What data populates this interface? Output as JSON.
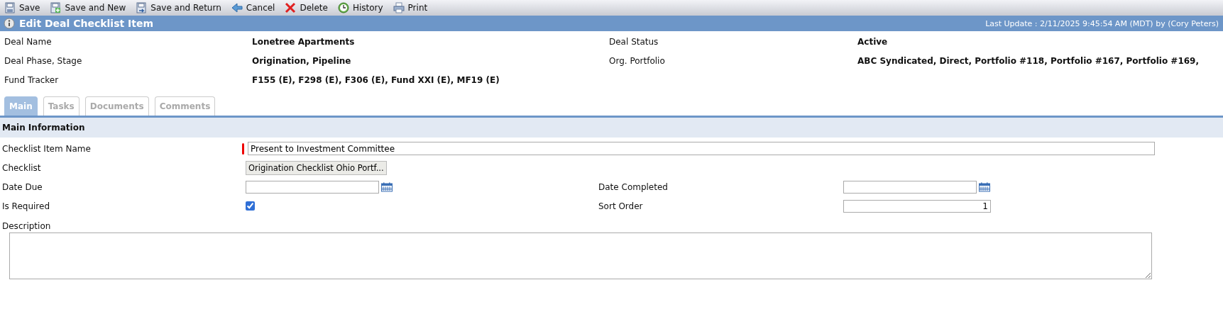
{
  "toolbar": [
    {
      "kind": "save",
      "label": "Save"
    },
    {
      "kind": "save-new",
      "label": "Save and New"
    },
    {
      "kind": "save-return",
      "label": "Save and Return"
    },
    {
      "kind": "cancel",
      "label": "Cancel"
    },
    {
      "kind": "delete",
      "label": "Delete"
    },
    {
      "kind": "history",
      "label": "History"
    },
    {
      "kind": "print",
      "label": "Print"
    }
  ],
  "header": {
    "title": "Edit Deal Checklist Item",
    "last_update": "Last Update : 2/11/2025 9:45:54 AM (MDT) by (Cory Peters)"
  },
  "summary": [
    [
      {
        "label": "Deal Name",
        "value": "Lonetree Apartments"
      },
      {
        "label": "Deal Status",
        "value": "Active"
      }
    ],
    [
      {
        "label": "Deal Phase, Stage",
        "value": "Origination, Pipeline"
      },
      {
        "label": "Org. Portfolio",
        "value": "ABC Syndicated, Direct, Portfolio #118, Portfolio #167, Portfolio #169,"
      }
    ],
    [
      {
        "label": "Fund Tracker",
        "value": "F155 (E), F298 (E), F306 (E), Fund XXI (E), MF19 (E)"
      }
    ]
  ],
  "tabs": [
    {
      "label": "Main",
      "selected": true
    },
    {
      "label": "Tasks",
      "selected": false
    },
    {
      "label": "Documents",
      "selected": false
    },
    {
      "label": "Comments",
      "selected": false
    }
  ],
  "section": {
    "title": "Main Information"
  },
  "form": [
    [
      {
        "kind": "text",
        "label": "Checklist Item Name",
        "value": "Present to Investment Committee",
        "required": true
      }
    ],
    [
      {
        "kind": "button",
        "label": "Checklist",
        "value": "Origination Checklist Ohio Portf..."
      }
    ],
    [
      {
        "kind": "date",
        "label": "Date Due"
      },
      {
        "kind": "date",
        "label": "Date Completed"
      }
    ],
    [
      {
        "kind": "checkbox",
        "label": "Is Required",
        "checked": true
      },
      {
        "kind": "number",
        "label": "Sort Order",
        "value": "1"
      }
    ]
  ],
  "description": {
    "label": "Description"
  }
}
